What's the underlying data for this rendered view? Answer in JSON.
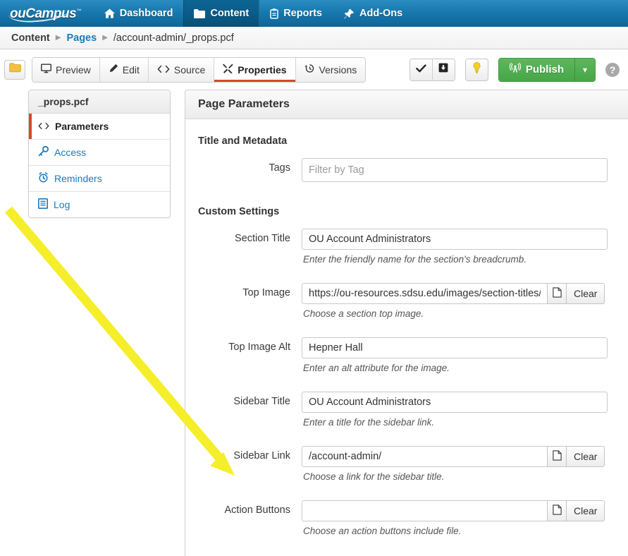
{
  "app": {
    "logo_text": "Campus",
    "logo_prefix": "ou",
    "logo_tm": "™"
  },
  "topnav": {
    "items": [
      {
        "label": "Dashboard",
        "icon": "home-icon",
        "active": false
      },
      {
        "label": "Content",
        "icon": "folder-icon",
        "active": true
      },
      {
        "label": "Reports",
        "icon": "clipboard-icon",
        "active": false
      },
      {
        "label": "Add-Ons",
        "icon": "pin-icon",
        "active": false
      }
    ]
  },
  "breadcrumb": {
    "items": [
      {
        "label": "Content",
        "type": "static"
      },
      {
        "label": "Pages",
        "type": "link"
      },
      {
        "label": "/account-admin/_props.pcf",
        "type": "current"
      }
    ],
    "separator": "▶"
  },
  "toolbar": {
    "folder_button": "folder-icon",
    "tabs": [
      {
        "label": "Preview",
        "icon": "monitor-icon",
        "active": false
      },
      {
        "label": "Edit",
        "icon": "pencil-icon",
        "active": false
      },
      {
        "label": "Source",
        "icon": "code-icon",
        "active": false
      },
      {
        "label": "Properties",
        "icon": "tools-icon",
        "active": true
      },
      {
        "label": "Versions",
        "icon": "clock-icon",
        "active": false
      }
    ],
    "actions": {
      "check_icon": "checkmark-icon",
      "save_icon": "save-box-icon",
      "bulb_icon": "lightbulb-icon",
      "publish_label": "Publish",
      "publish_icon": "broadcast-icon",
      "publish_caret": "▾",
      "help_label": "?"
    },
    "colors": {
      "publish_green": "#5cb85c",
      "active_tab_underline": "#d9472a",
      "bulb_yellow": "#f5d020"
    }
  },
  "sidebar": {
    "title": "_props.pcf",
    "items": [
      {
        "label": "Parameters",
        "icon": "code-icon",
        "active": true
      },
      {
        "label": "Access",
        "icon": "key-icon",
        "active": false
      },
      {
        "label": "Reminders",
        "icon": "alarm-clock-icon",
        "active": false
      },
      {
        "label": "Log",
        "icon": "log-document-icon",
        "active": false
      }
    ]
  },
  "panel": {
    "title": "Page Parameters",
    "sections": [
      {
        "heading": "Title and Metadata",
        "fields": [
          {
            "label": "Tags",
            "value": "",
            "placeholder": "Filter by Tag",
            "help": "",
            "has_buttons": false
          }
        ]
      },
      {
        "heading": "Custom Settings",
        "fields": [
          {
            "label": "Section Title",
            "value": "OU Account Administrators",
            "placeholder": "",
            "help": "Enter the friendly name for the section's breadcrumb.",
            "has_buttons": false
          },
          {
            "label": "Top Image",
            "value": "https://ou-resources.sdsu.edu/images/section-titles/section-title.jpg",
            "placeholder": "",
            "help": "Choose a section top image.",
            "has_buttons": true
          },
          {
            "label": "Top Image Alt",
            "value": "Hepner Hall",
            "placeholder": "",
            "help": "Enter an alt attribute for the image.",
            "has_buttons": false
          },
          {
            "label": "Sidebar Title",
            "value": "OU Account Administrators",
            "placeholder": "",
            "help": "Enter a title for the sidebar link.",
            "has_buttons": false
          },
          {
            "label": "Sidebar Link",
            "value": "/account-admin/",
            "placeholder": "",
            "help": "Choose a link for the sidebar title.",
            "has_buttons": true
          },
          {
            "label": "Action Buttons",
            "value": "",
            "placeholder": "",
            "help": "Choose an action buttons include file.",
            "has_buttons": true
          }
        ]
      }
    ],
    "file_button_icon": "page-icon",
    "clear_label": "Clear"
  },
  "annotation": {
    "arrow_color": "#f5ee2a",
    "points_at": "Sidebar Link"
  }
}
